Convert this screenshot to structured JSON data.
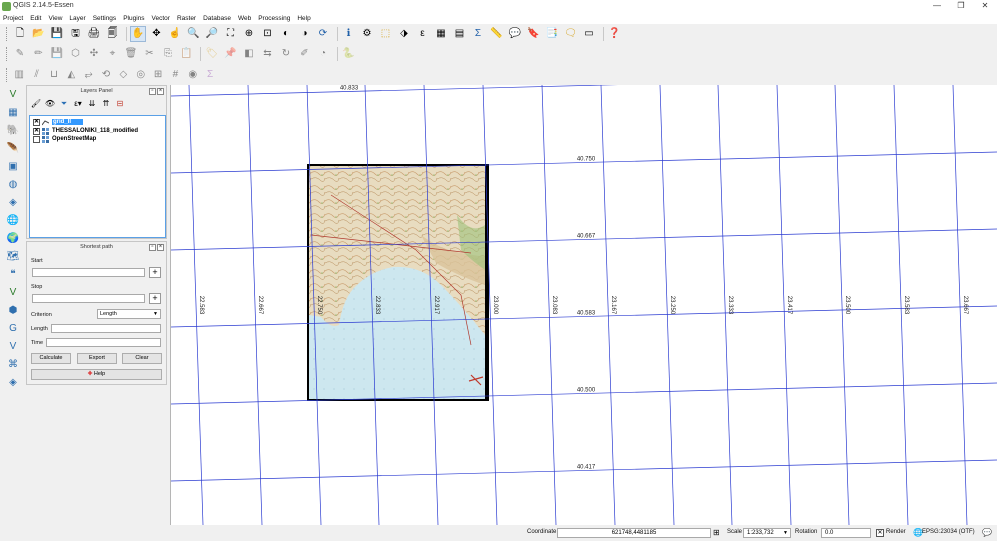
{
  "window": {
    "title": "QGIS 2.14.5-Essen",
    "minimize_glyph": "—",
    "maximize_glyph": "❐",
    "close_glyph": "✕"
  },
  "menu": [
    "Project",
    "Edit",
    "View",
    "Layer",
    "Settings",
    "Plugins",
    "Vector",
    "Raster",
    "Database",
    "Web",
    "Processing",
    "Help"
  ],
  "toolbar_icons": {
    "row1": [
      "new-project-icon",
      "open-project-icon",
      "save-project-icon",
      "save-as-icon",
      "print-composer-icon",
      "composer-manager-icon",
      "|",
      "pan-map-icon",
      "pan-to-selection-icon",
      "touch-zoom-icon",
      "zoom-in-icon",
      "zoom-out-icon",
      "zoom-full-icon",
      "zoom-to-selection-icon",
      "zoom-to-layer-icon",
      "zoom-last-icon",
      "zoom-next-icon",
      "refresh-icon",
      "|",
      "identify-icon",
      "measure-icon",
      "select-features-icon",
      "deselect-icon",
      "select-by-expression-icon",
      "field-calculator-icon",
      "open-attribute-table-icon",
      "statistics-icon",
      "measure-line-icon",
      "annotation-icon",
      "new-bookmark-icon",
      "show-bookmarks-icon",
      "map-tips-icon",
      "text-annotation-icon",
      "|",
      "help-icon"
    ],
    "row2": [
      "current-edits-icon",
      "toggle-editing-icon",
      "save-edits-icon",
      "add-feature-icon",
      "move-feature-icon",
      "node-tool-icon",
      "delete-selected-icon",
      "cut-features-icon",
      "copy-features-icon",
      "paste-features-icon",
      "|",
      "label-icon",
      "pin-labels-icon",
      "show-hide-labels-icon",
      "move-label-icon",
      "rotate-label-icon",
      "change-label-icon",
      "layer-diagram-icon",
      "|",
      "python-console-icon"
    ],
    "row3": [
      "digitize-icon",
      "split-features-icon",
      "merge-features-icon",
      "reshape-icon",
      "offset-curve-icon",
      "rotate-feature-icon",
      "simplify-icon",
      "add-ring-icon",
      "add-part-icon",
      "grid-icon",
      "fill-ring-icon",
      "attribute-icon"
    ],
    "vertical": [
      "add-vector-layer-icon",
      "add-raster-layer-icon",
      "add-postgis-icon",
      "add-spatialite-icon",
      "add-mssql-icon",
      "add-oracle-icon",
      "add-db2-icon",
      "add-wms-icon",
      "add-wcs-icon",
      "add-wfs-icon",
      "add-delimited-text-icon",
      "create-shapefile-icon",
      "create-spatialite-icon",
      "new-gpx-icon",
      "add-virtual-layer-icon",
      "add-wms-layer-icon",
      "add-osm-icon"
    ]
  },
  "layers_panel": {
    "title": "Layers Panel",
    "layers": [
      {
        "name": "grid_II",
        "checked": true,
        "selected": true
      },
      {
        "name": "THESSALONIKI_118_modified",
        "checked": true,
        "selected": false
      },
      {
        "name": "OpenStreetMap",
        "checked": false,
        "selected": false
      }
    ]
  },
  "shortest_path": {
    "title": "Shortest path",
    "start_label": "Start",
    "start_value": "",
    "stop_label": "Stop",
    "stop_value": "",
    "criterion_label": "Criterion",
    "criterion_value": "Length",
    "length_label": "Length",
    "length_value": "",
    "time_label": "Time",
    "time_value": "",
    "calculate": "Calculate",
    "export": "Export",
    "clear": "Clear",
    "help": "Help"
  },
  "map": {
    "lat_labels": [
      "40.833",
      "40.750",
      "40.667",
      "40.583",
      "40.500",
      "40.417"
    ],
    "lon_labels": [
      "22.583",
      "22.667",
      "22.750",
      "22.833",
      "22.917",
      "23.000",
      "23.083",
      "23.167",
      "23.250",
      "23.333",
      "23.417",
      "23.500",
      "23.583",
      "23.667"
    ],
    "grid_color": "#2b3bd1"
  },
  "status": {
    "coordinate_label": "Coordinate",
    "coordinate_value": "621748,4481185",
    "scale_label": "Scale",
    "scale_value": "1:233,732",
    "rotation_label": "Rotation",
    "rotation_value": "0.0",
    "render_label": "Render",
    "crs_label": "EPSG:23034 (OTF)"
  }
}
